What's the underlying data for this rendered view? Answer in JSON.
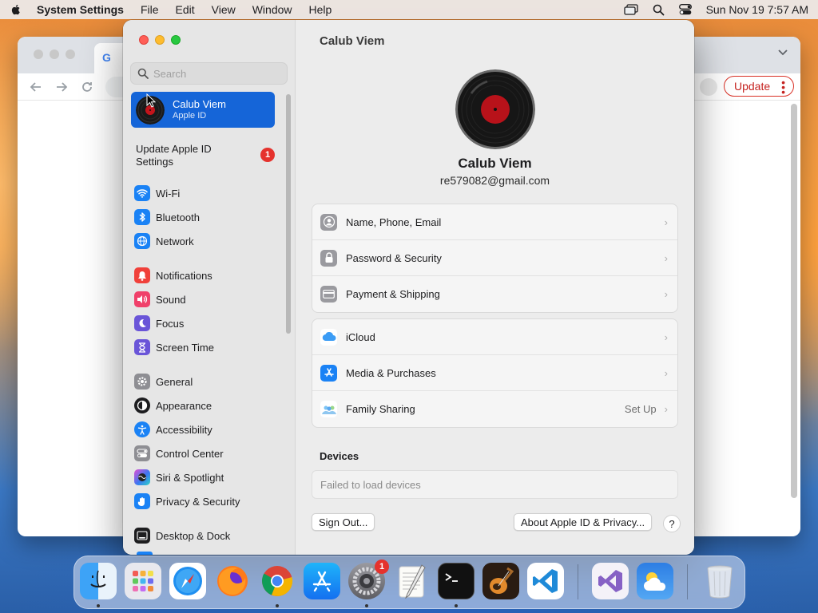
{
  "menubar": {
    "app_name": "System Settings",
    "menus": [
      "File",
      "Edit",
      "View",
      "Window",
      "Help"
    ],
    "clock": "Sun Nov 19  7:57 AM"
  },
  "chrome": {
    "update_label": "Update"
  },
  "settings": {
    "search_placeholder": "Search",
    "profile": {
      "name": "Calub Viem",
      "subtitle": "Apple ID"
    },
    "update_apple_id": {
      "label": "Update Apple ID Settings",
      "badge": "1"
    },
    "sidebar_groups": [
      [
        {
          "label": "Wi-Fi",
          "icon": "wifi-icon",
          "color": "#1a82f5"
        },
        {
          "label": "Bluetooth",
          "icon": "bluetooth-icon",
          "color": "#1a82f5"
        },
        {
          "label": "Network",
          "icon": "globe-icon",
          "color": "#1a82f5"
        }
      ],
      [
        {
          "label": "Notifications",
          "icon": "bell-icon",
          "color": "#f0403a"
        },
        {
          "label": "Sound",
          "icon": "speaker-icon",
          "color": "#f0406a"
        },
        {
          "label": "Focus",
          "icon": "moon-icon",
          "color": "#6a55d8"
        },
        {
          "label": "Screen Time",
          "icon": "hourglass-icon",
          "color": "#6a55d8"
        }
      ],
      [
        {
          "label": "General",
          "icon": "gear-icon",
          "color": "#8e8e93"
        },
        {
          "label": "Appearance",
          "icon": "appearance-icon",
          "color": "#1d1d1f"
        },
        {
          "label": "Accessibility",
          "icon": "accessibility-icon",
          "color": "#1a82f5"
        },
        {
          "label": "Control Center",
          "icon": "control-center-icon",
          "color": "#8e8e93"
        },
        {
          "label": "Siri & Spotlight",
          "icon": "siri-icon",
          "color": "#3a3a8c"
        },
        {
          "label": "Privacy & Security",
          "icon": "hand-icon",
          "color": "#1a82f5"
        }
      ],
      [
        {
          "label": "Desktop & Dock",
          "icon": "dock-icon",
          "color": "#1d1d1f"
        }
      ]
    ],
    "main": {
      "title": "Calub Viem",
      "name": "Calub Viem",
      "email": "re579082@gmail.com",
      "group1": [
        {
          "label": "Name, Phone, Email",
          "icon": "contact-icon",
          "color": "#8e8e93",
          "value": ""
        },
        {
          "label": "Password & Security",
          "icon": "lock-icon",
          "color": "#8e8e93",
          "value": ""
        },
        {
          "label": "Payment & Shipping",
          "icon": "card-icon",
          "color": "#8e8e93",
          "value": ""
        }
      ],
      "group2": [
        {
          "label": "iCloud",
          "icon": "icloud-icon",
          "color": "#ffffff",
          "value": ""
        },
        {
          "label": "Media & Purchases",
          "icon": "app-store-icon",
          "color": "#1a82f5",
          "value": ""
        },
        {
          "label": "Family Sharing",
          "icon": "family-icon",
          "color": "#ffffff",
          "value": "Set Up"
        }
      ],
      "devices_title": "Devices",
      "devices_status": "Failed to load devices",
      "sign_out_label": "Sign Out...",
      "about_label": "About Apple ID & Privacy...",
      "help_label": "?"
    }
  },
  "dock": {
    "system_settings_badge": "1",
    "apps": [
      "Finder",
      "Launchpad",
      "Safari",
      "Firefox",
      "Chrome",
      "App Store",
      "System Settings",
      "TextEdit",
      "Terminal",
      "GarageBand",
      "Visual Studio Code",
      "Visual Studio",
      "Weather",
      "Trash"
    ]
  }
}
